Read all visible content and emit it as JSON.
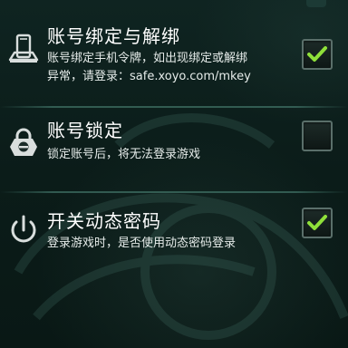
{
  "settings": {
    "items": [
      {
        "title": "账号绑定与解绑",
        "line1": "账号绑定手机令牌，如出现绑定或解绑",
        "line2": "异常，请登录：safe.xoyo.com/mkey",
        "checked": true,
        "icon": "phone-bind-icon"
      },
      {
        "title": "账号锁定",
        "line1": "锁定账号后，将无法登录游戏",
        "checked": false,
        "icon": "lock-icon"
      },
      {
        "title": "开关动态密码",
        "line1": "登录游戏时，是否使用动态密码登录",
        "checked": true,
        "icon": "power-icon"
      }
    ]
  },
  "colors": {
    "check_mark": "#8fe03a",
    "background": "#0c1e1b",
    "divider": "#508c7d"
  }
}
